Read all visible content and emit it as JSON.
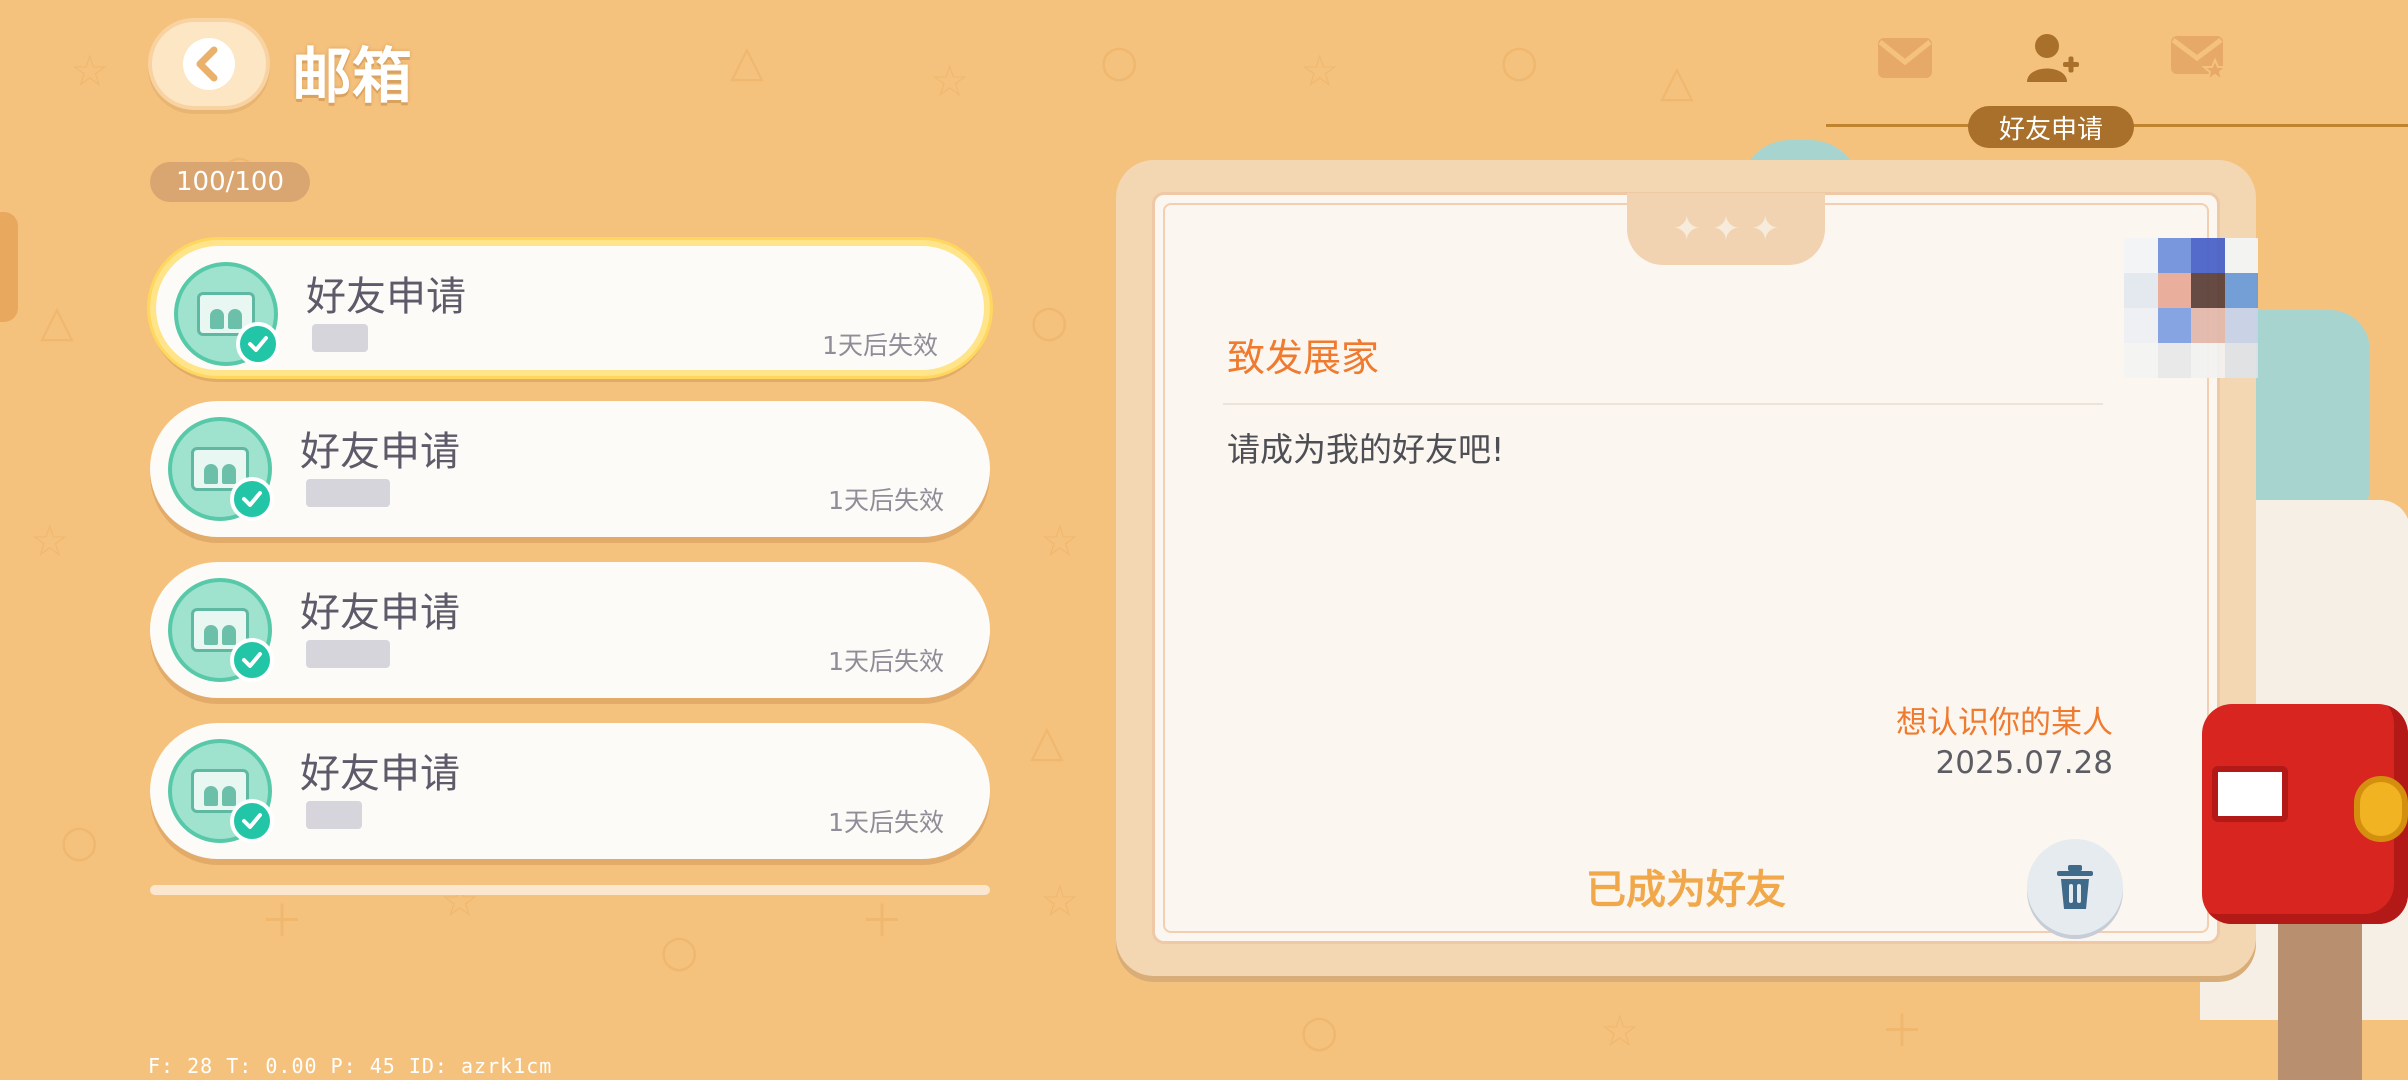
{
  "header": {
    "title": "邮箱"
  },
  "counter": "100/100",
  "tabs": {
    "icons": [
      "mail-icon",
      "add-friend-icon",
      "starred-mail-icon"
    ],
    "active_label": "好友申请"
  },
  "mail_list": [
    {
      "title": "好友申请",
      "expire": "1天后失效",
      "selected": true
    },
    {
      "title": "好友申请",
      "expire": "1天后失效",
      "selected": false
    },
    {
      "title": "好友申请",
      "expire": "1天后失效",
      "selected": false
    },
    {
      "title": "好友申请",
      "expire": "1天后失效",
      "selected": false
    }
  ],
  "letter": {
    "recipient": "致发展家",
    "body": "请成为我的好友吧!",
    "sender": "想认识你的某人",
    "date": "2025.07.28",
    "status": "已成为好友"
  },
  "debug_text": "F: 28    T: 0.00    P: 45    ID: azrk1cm",
  "colors": {
    "background": "#f5c27e",
    "accent_orange": "#f07a2e",
    "status_gold": "#f0a84b",
    "check_teal": "#23c5a7"
  }
}
